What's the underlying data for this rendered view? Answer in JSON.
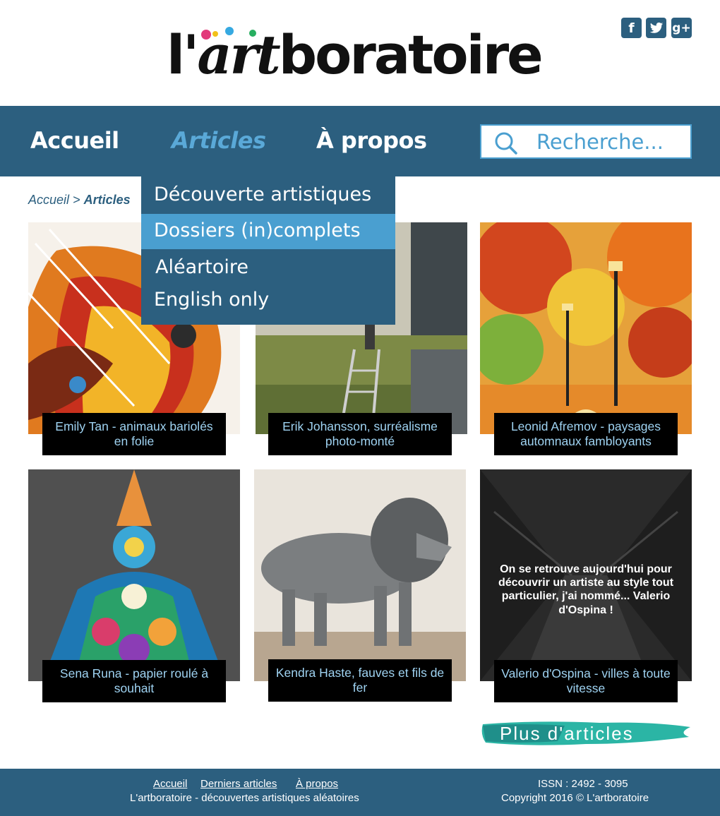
{
  "brand": {
    "logo_prefix": "l'",
    "logo_art": "art",
    "logo_suffix": "boratoire",
    "color": "#2c5f7f",
    "accent": "#4a9fd0"
  },
  "social": [
    {
      "icon": "facebook-icon",
      "glyph": "f"
    },
    {
      "icon": "twitter-icon",
      "glyph": "🐦"
    },
    {
      "icon": "google-plus-icon",
      "glyph": "g+"
    }
  ],
  "nav": {
    "items": [
      {
        "label": "Accueil"
      },
      {
        "label": "Articles"
      },
      {
        "label": "À propos"
      }
    ],
    "active": "Articles",
    "search_placeholder": "Recherche..."
  },
  "dropdown": {
    "items": [
      {
        "label": "Découverte artistiques"
      },
      {
        "label": "Dossiers (in)complets"
      },
      {
        "label": "Aléartoire"
      },
      {
        "label": "English only"
      }
    ],
    "highlighted": "Dossiers (in)complets"
  },
  "breadcrumb": {
    "home": "Accueil",
    "sep": ">",
    "current": "Articles"
  },
  "articles": [
    {
      "caption": "Emily Tan - animaux bariolés en folie"
    },
    {
      "caption": "Erik Johansson, surréalisme photo-monté"
    },
    {
      "caption": "Leonid Afremov - paysages automnaux fambloyants"
    },
    {
      "caption": "Sena Runa - papier roulé à souhait"
    },
    {
      "caption": "Kendra Haste, fauves et fils de fer"
    },
    {
      "caption": "Valerio d'Ospina - villes à toute vitesse",
      "overlay": "On se retrouve aujourd'hui pour découvrir un artiste au style tout particulier, j'ai nommé... Valerio d'Ospina !"
    }
  ],
  "more_button": "Plus d'articles",
  "footer": {
    "links": [
      {
        "label": "Accueil"
      },
      {
        "label": "Derniers articles"
      },
      {
        "label": "À propos"
      }
    ],
    "tagline": "L'artboratoire - découvertes artistiques aléatoires",
    "issn": "ISSN : 2492 - 3095",
    "copyright": "Copyright 2016 © L'artboratoire"
  }
}
